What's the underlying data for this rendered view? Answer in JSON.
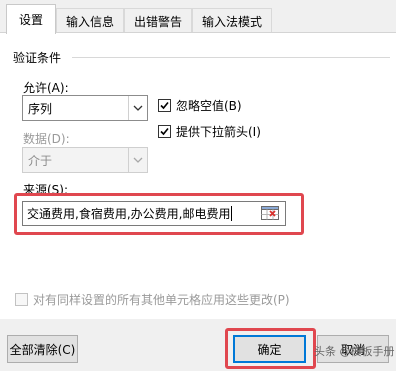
{
  "tabs": [
    {
      "label": "设置",
      "active": true
    },
    {
      "label": "输入信息",
      "active": false
    },
    {
      "label": "出错警告",
      "active": false
    },
    {
      "label": "输入法模式",
      "active": false
    }
  ],
  "validation": {
    "section_title": "验证条件",
    "allow_label": "允许(A):",
    "allow_value": "序列",
    "data_label": "数据(D):",
    "data_value": "介于",
    "ignore_blank_label": "忽略空值(B)",
    "ignore_blank_checked": true,
    "dropdown_label": "提供下拉箭头(I)",
    "dropdown_checked": true,
    "source_label": "来源(S):",
    "source_value": "交通费用,食宿费用,办公费用,邮电费用"
  },
  "apply_all": {
    "label": "对有同样设置的所有其他单元格应用这些更改(P)",
    "checked": false,
    "enabled": false
  },
  "buttons": {
    "clear_all": "全部清除(C)",
    "ok": "确定",
    "cancel": "取消"
  },
  "watermark": "头条 @模板手册",
  "colors": {
    "highlight": "#e0474f",
    "focus": "#0078d7"
  }
}
